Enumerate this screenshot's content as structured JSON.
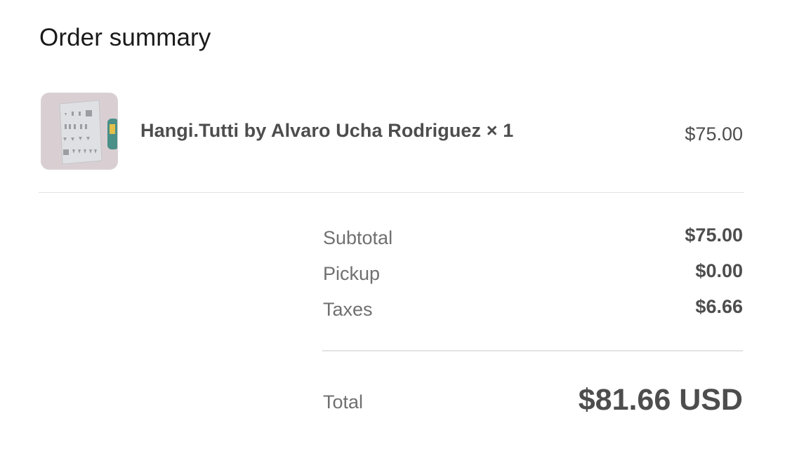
{
  "order_summary": {
    "title": "Order summary"
  },
  "line_items": [
    {
      "name": "Hangi.Tutti by Alvaro Ucha Rodriguez × 1",
      "price": "$75.00",
      "thumbnail_icon": "product-thumbnail"
    }
  ],
  "summary": {
    "subtotal_label": "Subtotal",
    "subtotal_value": "$75.00",
    "pickup_label": "Pickup",
    "pickup_value": "$0.00",
    "taxes_label": "Taxes",
    "taxes_value": "$6.66",
    "total_label": "Total",
    "total_value": "$81.66 USD"
  },
  "colors": {
    "text_dark": "#1a1a1a",
    "text_primary": "#4d4d4d",
    "text_muted": "#707070",
    "divider": "#e3e3e3",
    "thumbnail_bg": "#d9cfd2"
  }
}
